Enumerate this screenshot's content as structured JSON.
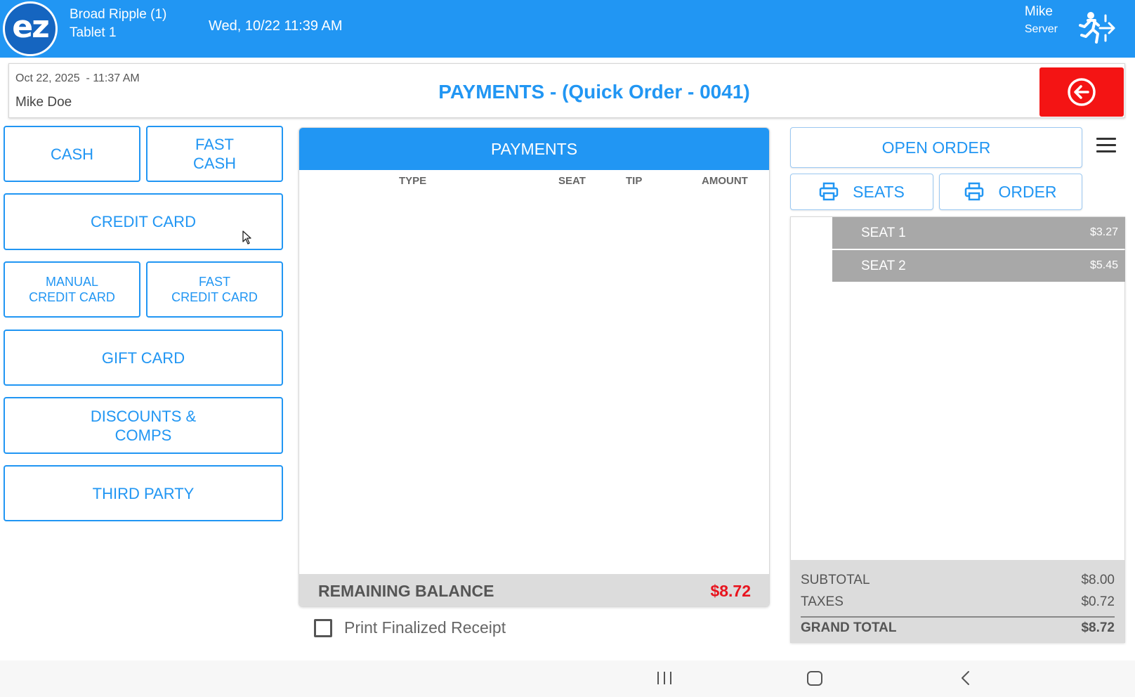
{
  "topbar": {
    "logo_text": "ez",
    "location": "Broad Ripple (1)",
    "device": "Tablet 1",
    "datetime": "Wed, 10/22 11:39 AM",
    "user_name": "Mike",
    "user_role": "Server",
    "logout_icon": "exit-running-man-icon"
  },
  "header": {
    "order_date": "Oct 22, 2025  - 11:37 AM",
    "customer": "Mike Doe",
    "title": "PAYMENTS - (Quick Order - 0041)",
    "back_icon": "circle-arrow-left-icon",
    "back_color": "#f41414"
  },
  "payment_methods": {
    "cash": "CASH",
    "fast_cash": "FAST\nCASH",
    "credit_card": "CREDIT CARD",
    "manual_credit_card": "MANUAL\nCREDIT CARD",
    "fast_credit_card": "FAST\nCREDIT CARD",
    "gift_card": "GIFT CARD",
    "discounts": "DISCOUNTS &\nCOMPS",
    "third_party": "THIRD PARTY"
  },
  "payments": {
    "title": "PAYMENTS",
    "columns": [
      "TYPE",
      "SEAT",
      "TIP",
      "AMOUNT"
    ],
    "rows": [],
    "remaining_label": "REMAINING BALANCE",
    "remaining_amount": "$8.72",
    "remaining_color": "#e8141e"
  },
  "receipt": {
    "label": "Print Finalized Receipt",
    "checked": false
  },
  "order_panel": {
    "open_order": "OPEN ORDER",
    "print_seats": "SEATS",
    "print_order": "ORDER",
    "menu_icon": "hamburger-menu-icon",
    "seats": [
      {
        "name": "SEAT 1",
        "amount": "$3.27"
      },
      {
        "name": "SEAT 2",
        "amount": "$5.45"
      }
    ],
    "totals": {
      "subtotal_label": "SUBTOTAL",
      "subtotal": "$8.00",
      "taxes_label": "TAXES",
      "taxes": "$0.72",
      "grand_label": "GRAND TOTAL",
      "grand": "$8.72"
    }
  },
  "accent_color": "#2196f3"
}
